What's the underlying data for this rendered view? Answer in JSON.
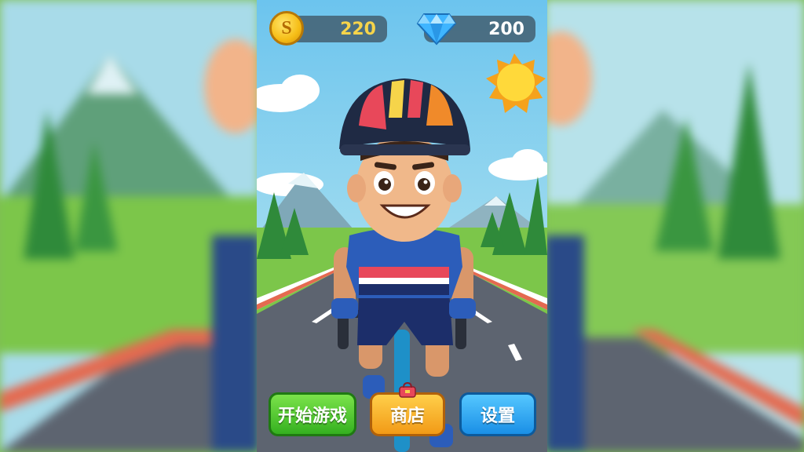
{
  "hud": {
    "coins": {
      "icon": "coin-icon",
      "symbol": "S",
      "value": "220"
    },
    "gems": {
      "icon": "diamond-icon",
      "value": "200"
    }
  },
  "buttons": {
    "start": {
      "label": "开始游戏",
      "color": "#35b020"
    },
    "shop": {
      "label": "商店",
      "color": "#f29a16",
      "icon": "shopping-bag-icon"
    },
    "settings": {
      "label": "设置",
      "color": "#1a8fe6"
    }
  },
  "scene": {
    "character": "cyclist-character",
    "sky_color": "#8fd3f2",
    "grass_color": "#7cc64a",
    "road_color": "#5d6470"
  }
}
